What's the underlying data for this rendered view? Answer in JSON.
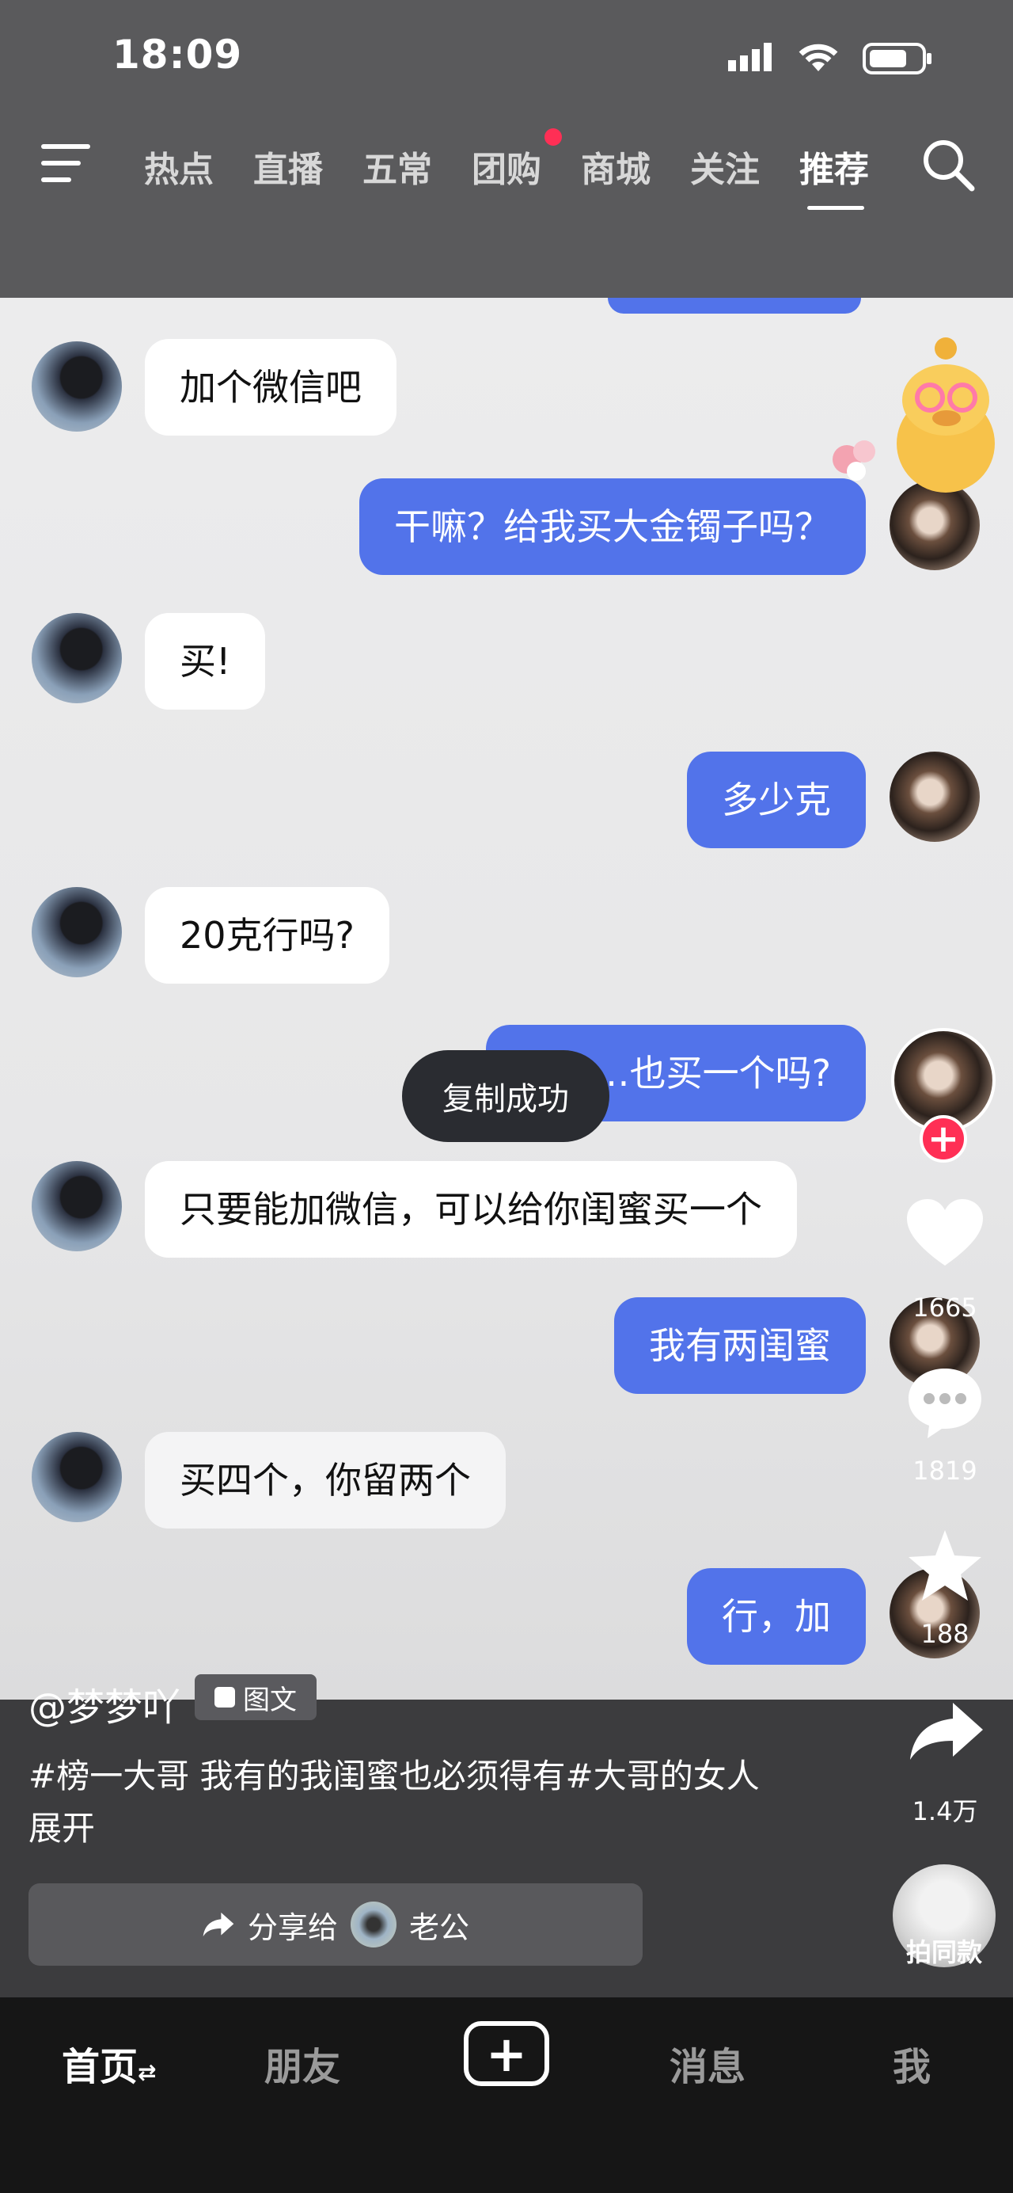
{
  "status_bar": {
    "time": "18:09"
  },
  "nav": {
    "tabs": [
      "热点",
      "直播",
      "五常",
      "团购",
      "商城",
      "关注",
      "推荐"
    ],
    "active": "推荐"
  },
  "chat": {
    "messages": [
      {
        "side": "left",
        "text": "加个微信吧"
      },
      {
        "side": "right",
        "text": "干嘛？给我买大金镯子吗？"
      },
      {
        "side": "left",
        "text": "买!"
      },
      {
        "side": "right",
        "text": "多少克"
      },
      {
        "side": "left",
        "text": "20克行吗?"
      },
      {
        "side": "right",
        "text": "能……也买一个吗?"
      },
      {
        "side": "left",
        "text": "只要能加微信，可以给你闺蜜买一个"
      },
      {
        "side": "right",
        "text": "我有两闺蜜"
      },
      {
        "side": "left",
        "text": "买四个，你留两个"
      },
      {
        "side": "right",
        "text": "行，加"
      }
    ],
    "toast": "复制成功"
  },
  "rail": {
    "likes": "1665",
    "comments": "1819",
    "favorites": "188",
    "shares": "1.4万",
    "same_style": "拍同款"
  },
  "post": {
    "author": "@梦梦吖",
    "type_chip": "图文",
    "description": "#榜一大哥 我有的我闺蜜也必须得有#大哥的女人",
    "expand": "展开",
    "share_to_label": "分享给",
    "share_to_name": "老公"
  },
  "tabbar": {
    "home": "首页",
    "friends": "朋友",
    "messages": "消息",
    "me": "我"
  },
  "colors": {
    "accent_blue": "#5273ea",
    "heart_red": "#ff2f55"
  }
}
